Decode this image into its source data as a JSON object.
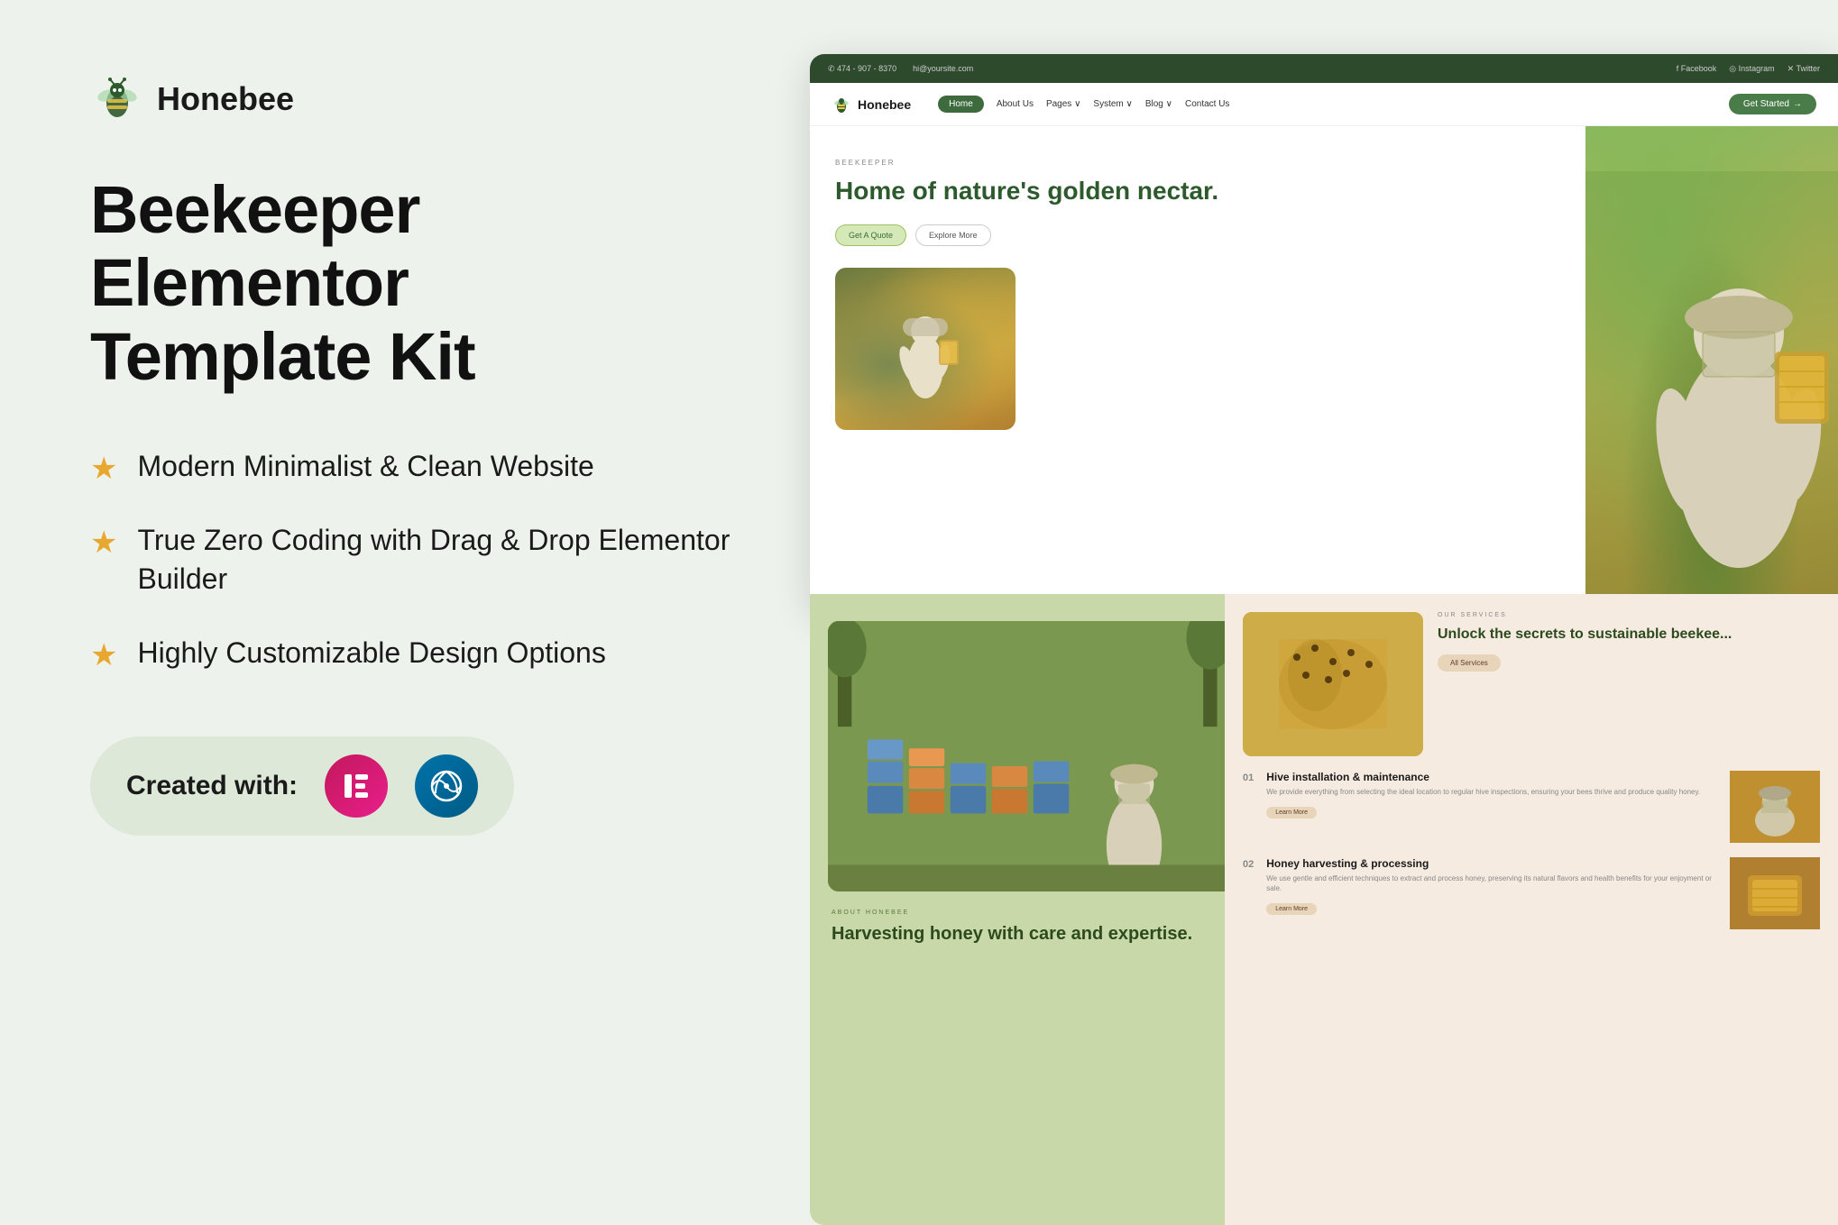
{
  "brand": {
    "name": "Honebee",
    "tagline": "Beekeeper Elementor Template Kit"
  },
  "left": {
    "logo_text": "Honebee",
    "title_line1": "Beekeeper",
    "title_line2": "Elementor",
    "title_line3": "Template Kit",
    "features": [
      {
        "id": 1,
        "text": "Modern Minimalist & Clean Website"
      },
      {
        "id": 2,
        "text": "True Zero Coding with Drag & Drop Elementor Builder"
      },
      {
        "id": 3,
        "text": "Highly Customizable Design Options"
      }
    ],
    "created_with_label": "Created with:",
    "badges": [
      "Elementor",
      "WordPress"
    ]
  },
  "preview": {
    "topbar": {
      "phone": "✆ 474 - 907 - 8370",
      "email": "hi@yoursite.com",
      "social": [
        "Facebook",
        "Instagram",
        "X Twitter"
      ]
    },
    "nav": {
      "logo": "Honebee",
      "links": [
        "Home",
        "About Us",
        "Pages",
        "System",
        "Blog",
        "Contact Us"
      ],
      "active": "Home",
      "cta": "Get Started"
    },
    "hero": {
      "tag": "BEEKEEPER",
      "title": "Home of nature's golden nectar.",
      "btn1": "Get A Quote",
      "btn2": "Explore More"
    },
    "about": {
      "tag": "ABOUT HONEBEE",
      "title": "Harvesting honey with care and expertise."
    },
    "services": {
      "tag": "OUR SERVICES",
      "title": "Unlock the secrets to sustainable beekee...",
      "all_services_btn": "All Services",
      "items": [
        {
          "num": "01",
          "title": "Hive installation & maintenance",
          "desc": "We provide everything from selecting the ideal location to regular hive inspections, ensuring your bees thrive and produce quality honey.",
          "btn": "Learn More"
        },
        {
          "num": "02",
          "title": "Honey harvesting & processing",
          "desc": "We use gentle and efficient techniques to extract and process honey, preserving its natural flavors and health benefits for your enjoyment or sale.",
          "btn": "Learn More"
        }
      ]
    }
  },
  "colors": {
    "brand_green": "#2d5a2d",
    "nav_green": "#3d6b3d",
    "star_gold": "#e8a830",
    "bg_light": "#eef2ec",
    "elementor_pink": "#c2185b",
    "wordpress_blue": "#0073aa"
  }
}
